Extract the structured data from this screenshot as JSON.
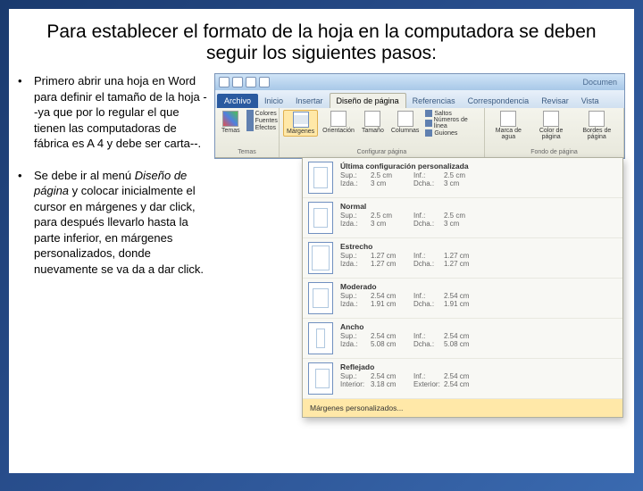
{
  "title": "Para establecer el formato de la hoja en la computadora se deben seguir los siguientes pasos:",
  "bullets": [
    "Primero abrir una hoja en Word para definir el tamaño de la hoja --ya que por lo regular el que tienen las computadoras de fábrica es A 4 y debe ser carta--.",
    "Se debe ir al menú Diseño de página y colocar inicialmente el cursor en márgenes y dar click, para después llevarlo hasta la parte inferior, en márgenes personalizados, donde nuevamente se va da a dar click."
  ],
  "italic_phrase": "Diseño de página",
  "word": {
    "qat_title": "Documen",
    "file_tab": "Archivo",
    "tabs": [
      "Inicio",
      "Insertar",
      "Diseño de página",
      "Referencias",
      "Correspondencia",
      "Revisar",
      "Vista"
    ],
    "active_tab": "Diseño de página",
    "groups": {
      "temas": {
        "label": "Temas",
        "items": [
          "Temas",
          "Colores",
          "Fuentes",
          "Efectos"
        ]
      },
      "config": {
        "label": "Configurar página",
        "margenes": "Márgenes",
        "orientacion": "Orientación",
        "tamano": "Tamaño",
        "columnas": "Columnas",
        "saltos": "Saltos",
        "numeros": "Números de línea",
        "guiones": "Guiones"
      },
      "fondo": {
        "label": "Fondo de página",
        "marca": "Marca de agua",
        "color": "Color de página",
        "bordes": "Bordes de página"
      }
    },
    "margins_dropdown": {
      "last": {
        "name": "Última configuración personalizada",
        "sup": "2.5 cm",
        "izq": "3 cm",
        "inf": "2.5 cm",
        "dcha": "3 cm"
      },
      "normal": {
        "name": "Normal",
        "sup": "2.5 cm",
        "izq": "3 cm",
        "inf": "2.5 cm",
        "dcha": "3 cm"
      },
      "estrecho": {
        "name": "Estrecho",
        "sup": "1.27 cm",
        "izq": "1.27 cm",
        "inf": "1.27 cm",
        "dcha": "1.27 cm"
      },
      "moderado": {
        "name": "Moderado",
        "sup": "2.54 cm",
        "izq": "1.91 cm",
        "inf": "2.54 cm",
        "dcha": "1.91 cm"
      },
      "ancho": {
        "name": "Ancho",
        "sup": "2.54 cm",
        "izq": "5.08 cm",
        "inf": "2.54 cm",
        "dcha": "5.08 cm"
      },
      "reflejado": {
        "name": "Reflejado",
        "sup": "2.54 cm",
        "interior": "3.18 cm",
        "inf": "2.54 cm",
        "exterior": "2.54 cm"
      },
      "custom": "Márgenes personalizados...",
      "labels": {
        "sup": "Sup.:",
        "inf": "Inf.:",
        "izq": "Izda.:",
        "dcha": "Dcha.:",
        "interior": "Interior:",
        "exterior": "Exterior:"
      }
    }
  }
}
